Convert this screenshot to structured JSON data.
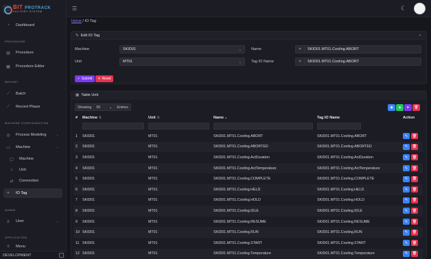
{
  "logo": {
    "part1": "BIT",
    "part2": "PROTRACK",
    "line2": "FACTORY SYSTEM"
  },
  "sidebar": {
    "dashboard": "Dashboard",
    "section_procedure": "PROCEDURE",
    "procedure": "Procedure",
    "procedure_editor": "Procedure Editor",
    "section_report": "REPORT",
    "batch": "Batch",
    "record_phase": "Record Phase",
    "section_machine_config": "MACHINE CONFIGURATION",
    "process_modeling": "Process Modeling",
    "machine_group": "Machine",
    "machine": "Machine",
    "unit": "Unit",
    "connection": "Connection",
    "io_tag": "IO Tag",
    "section_admin": "ADMIN",
    "user": "User",
    "section_application": "APPLICATION",
    "menu": "Menu",
    "environment": "DEVELOPMENT"
  },
  "breadcrumb": {
    "home": "Home",
    "separator": "/",
    "current": "IO Tag"
  },
  "edit_card": {
    "title": "Edit IO Tag",
    "machine_label": "Machine",
    "machine_value": "SKID01",
    "unit_label": "Unit",
    "unit_value": "MT01",
    "name_label": "Name",
    "name_value": "SKID01.MT01.Cooling.ABORT",
    "tag_io_label": "Tag IO Name",
    "tag_io_value": "SKID01.MT01.Cooling.ABORT",
    "submit": "Submit",
    "reset": "Reset"
  },
  "table_card": {
    "title": "Table Unit",
    "showing": "Showing",
    "page_size": "50",
    "entries": "Entries",
    "columns": [
      "#",
      "Machine",
      "Unit",
      "Name",
      "Tag IO Name",
      "Action"
    ],
    "rows": [
      [
        "1",
        "SKID01",
        "MT01",
        "SKID01.MT01.Cooling.ABORT",
        "SKID01.MT01.Cooling.ABORT"
      ],
      [
        "2",
        "SKID01",
        "MT01",
        "SKID01.MT01.Cooling.ABORTED",
        "SKID01.MT01.Cooling.ABORTED"
      ],
      [
        "3",
        "SKID01",
        "MT01",
        "SKID01.MT01.Cooling.ActDuration",
        "SKID01.MT01.Cooling.ActDuration"
      ],
      [
        "4",
        "SKID01",
        "MT01",
        "SKID01.MT01.Cooling.ActTemperature",
        "SKID01.MT01.Cooling.ActTemperature"
      ],
      [
        "5",
        "SKID01",
        "MT01",
        "SKID01.MT01.Cooling.COMPLETE",
        "SKID01.MT01.Cooling.COMPLETE"
      ],
      [
        "6",
        "SKID01",
        "MT01",
        "SKID01.MT01.Cooling.HELD",
        "SKID01.MT01.Cooling.HELD"
      ],
      [
        "7",
        "SKID01",
        "MT01",
        "SKID01.MT01.Cooling.HOLD",
        "SKID01.MT01.Cooling.HOLD"
      ],
      [
        "8",
        "SKID01",
        "MT01",
        "SKID01.MT01.Cooling.IDLE",
        "SKID01.MT01.Cooling.IDLE"
      ],
      [
        "9",
        "SKID01",
        "MT01",
        "SKID01.MT01.Cooling.RESUME",
        "SKID01.MT01.Cooling.RESUME"
      ],
      [
        "10",
        "SKID01",
        "MT01",
        "SKID01.MT01.Cooling.RUN",
        "SKID01.MT01.Cooling.RUN"
      ],
      [
        "11",
        "SKID01",
        "MT01",
        "SKID01.MT01.Cooling.START",
        "SKID01.MT01.Cooling.START"
      ],
      [
        "12",
        "SKID01",
        "MT01",
        "SKID01.MT01.Cooling.Temperature",
        "SKID01.MT01.Cooling.Temperature"
      ]
    ]
  },
  "colors": {
    "primary": "#7c3aed",
    "danger": "#e3344f",
    "info": "#3b82f6",
    "success": "#22c55e",
    "link": "#8b7cf6"
  }
}
